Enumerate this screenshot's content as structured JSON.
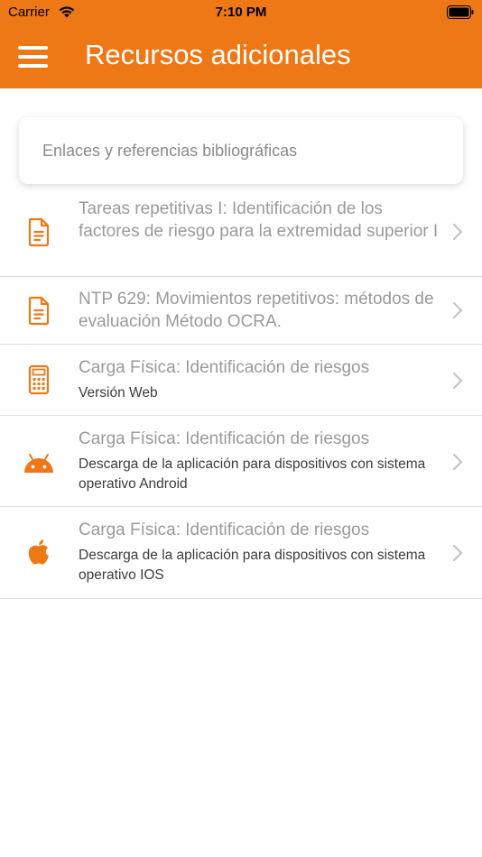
{
  "status_bar": {
    "carrier": "Carrier",
    "time": "7:10 PM"
  },
  "header": {
    "title": "Recursos adicionales",
    "menu_icon": "hamburger-icon"
  },
  "section": {
    "label": "Enlaces y referencias bibliográficas"
  },
  "items": [
    {
      "icon": "document-icon",
      "title": "Tareas repetitivas I: Identificación de los factores de riesgo para la extremidad superior I",
      "subtitle": ""
    },
    {
      "icon": "document-icon",
      "title": "NTP 629: Movimientos repetitivos: métodos de evaluación Método OCRA.",
      "subtitle": ""
    },
    {
      "icon": "calculator-icon",
      "title": "Carga Física: Identificación de riesgos",
      "subtitle": "Versión Web"
    },
    {
      "icon": "android-icon",
      "title": "Carga Física: Identificación de riesgos",
      "subtitle": "Descarga de la aplicación para dispositivos con sistema operativo Android"
    },
    {
      "icon": "apple-icon",
      "title": "Carga Física: Identificación de riesgos",
      "subtitle": "Descarga de la aplicación para dispositivos con sistema operativo IOS"
    }
  ],
  "colors": {
    "accent": "#EE7716",
    "title_text": "#9a9a9a",
    "subtitle_text": "#3c3c3c"
  }
}
